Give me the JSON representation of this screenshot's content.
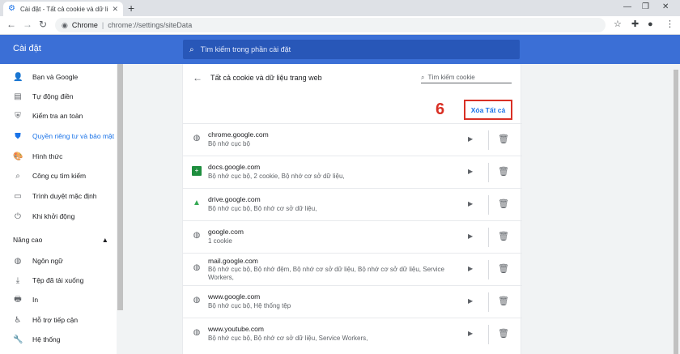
{
  "browser": {
    "tab_title": "Cài đặt - Tất cả cookie và dữ liệu...",
    "address_brand": "Chrome",
    "address_url": "chrome://settings/siteData",
    "icons": [
      "settings-gear-icon",
      "close-icon",
      "plus-icon",
      "minimize-icon",
      "restore-icon",
      "close-window-icon",
      "back-icon",
      "forward-icon",
      "reload-icon",
      "star-icon",
      "extensions-icon",
      "profile-icon",
      "menu-icon"
    ]
  },
  "header": {
    "app_name": "Cài đặt",
    "search_placeholder": "Tìm kiếm trong phần cài đặt"
  },
  "sidebar": {
    "items": [
      {
        "label": "Bạn và Google",
        "icon": "person-icon"
      },
      {
        "label": "Tự động điền",
        "icon": "clipboard-icon"
      },
      {
        "label": "Kiểm tra an toàn",
        "icon": "shield-check-icon"
      },
      {
        "label": "Quyền riêng tư và bảo mật",
        "icon": "shield-icon",
        "active": true
      },
      {
        "label": "Hình thức",
        "icon": "palette-icon"
      },
      {
        "label": "Công cụ tìm kiếm",
        "icon": "search-icon"
      },
      {
        "label": "Trình duyệt mặc định",
        "icon": "browser-icon"
      },
      {
        "label": "Khi khởi động",
        "icon": "power-icon"
      }
    ],
    "advanced_label": "Nâng cao",
    "advanced_items": [
      {
        "label": "Ngôn ngữ",
        "icon": "globe-icon"
      },
      {
        "label": "Tệp đã tải xuống",
        "icon": "download-icon"
      },
      {
        "label": "In",
        "icon": "printer-icon"
      },
      {
        "label": "Hỗ trợ tiếp cận",
        "icon": "accessibility-icon"
      },
      {
        "label": "Hệ thống",
        "icon": "wrench-icon"
      }
    ]
  },
  "main": {
    "title": "Tất cả cookie và dữ liệu trang web",
    "search_placeholder": "Tìm kiếm cookie",
    "annotation_number": "6",
    "delete_all_label": "Xóa Tất cả",
    "sites": [
      {
        "domain": "chrome.google.com",
        "desc": "Bộ nhớ cục bộ",
        "icon": "globe-icon"
      },
      {
        "domain": "docs.google.com",
        "desc": "Bộ nhớ cục bộ, 2 cookie, Bộ nhớ cơ sở dữ liệu,",
        "icon": "docs-icon"
      },
      {
        "domain": "drive.google.com",
        "desc": "Bộ nhớ cục bộ, Bộ nhớ cơ sở dữ liệu,",
        "icon": "drive-icon"
      },
      {
        "domain": "google.com",
        "desc": "1 cookie",
        "icon": "globe-icon"
      },
      {
        "domain": "mail.google.com",
        "desc": "Bộ nhớ cục bộ, Bộ nhớ đệm, Bộ nhớ cơ sở dữ liệu, Bộ nhớ cơ sở dữ liệu, Service Workers,",
        "icon": "globe-icon"
      },
      {
        "domain": "www.google.com",
        "desc": "Bộ nhớ cục bộ, Hệ thống tệp",
        "icon": "globe-icon"
      },
      {
        "domain": "www.youtube.com",
        "desc": "Bộ nhớ cục bộ, Bộ nhớ cơ sở dữ liệu, Service Workers,",
        "icon": "globe-icon"
      }
    ]
  },
  "colors": {
    "accent": "#1a73e8",
    "header": "#3b6fd6",
    "annotation": "#d93025"
  }
}
